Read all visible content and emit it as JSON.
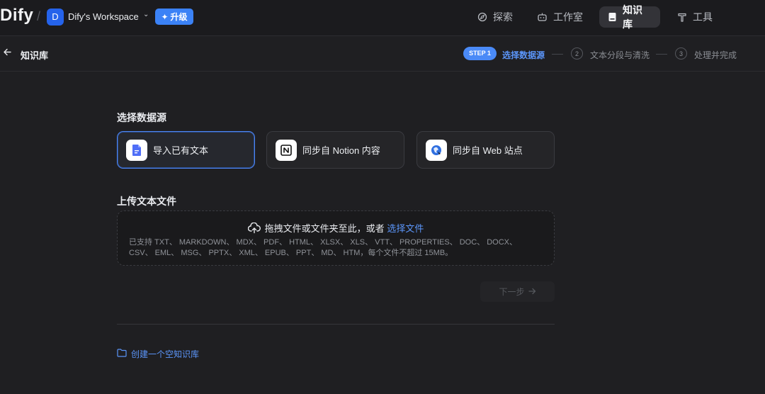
{
  "app": {
    "logo": "Dify",
    "workspace_initial": "D",
    "workspace_name": "Dify's Workspace",
    "upgrade_label": "升级"
  },
  "nav": [
    {
      "label": "探索",
      "icon": "compass-icon"
    },
    {
      "label": "工作室",
      "icon": "robot-icon"
    },
    {
      "label": "知识库",
      "icon": "book-icon",
      "active": true
    },
    {
      "label": "工具",
      "icon": "hammer-icon"
    }
  ],
  "subheader": {
    "title": "知识库",
    "steps": [
      {
        "badge": "STEP 1",
        "label": "选择数据源",
        "active": true
      },
      {
        "number": "2",
        "label": "文本分段与清洗"
      },
      {
        "number": "3",
        "label": "处理并完成"
      }
    ]
  },
  "content": {
    "source_title": "选择数据源",
    "sources": [
      {
        "label": "导入已有文本",
        "icon": "document-icon",
        "selected": true
      },
      {
        "label": "同步自 Notion 内容",
        "icon": "notion-icon"
      },
      {
        "label": "同步自 Web 站点",
        "icon": "web-icon"
      }
    ],
    "upload_title": "上传文本文件",
    "dropzone": {
      "text": "拖拽文件或文件夹至此，或者",
      "link": "选择文件",
      "supported_line1": "已支持 TXT、 MARKDOWN、 MDX、 PDF、 HTML、 XLSX、 XLS、 VTT、 PROPERTIES、 DOC、 DOCX、",
      "supported_line2": "CSV、 EML、 MSG、 PPTX、 XML、 EPUB、 PPT、 MD、 HTM，每个文件不超过 15MB。"
    },
    "next_label": "下一步",
    "create_empty_label": "创建一个空知识库"
  },
  "colors": {
    "accent": "#3b82f6",
    "link": "#5b95f9",
    "background": "#1f1f22"
  }
}
